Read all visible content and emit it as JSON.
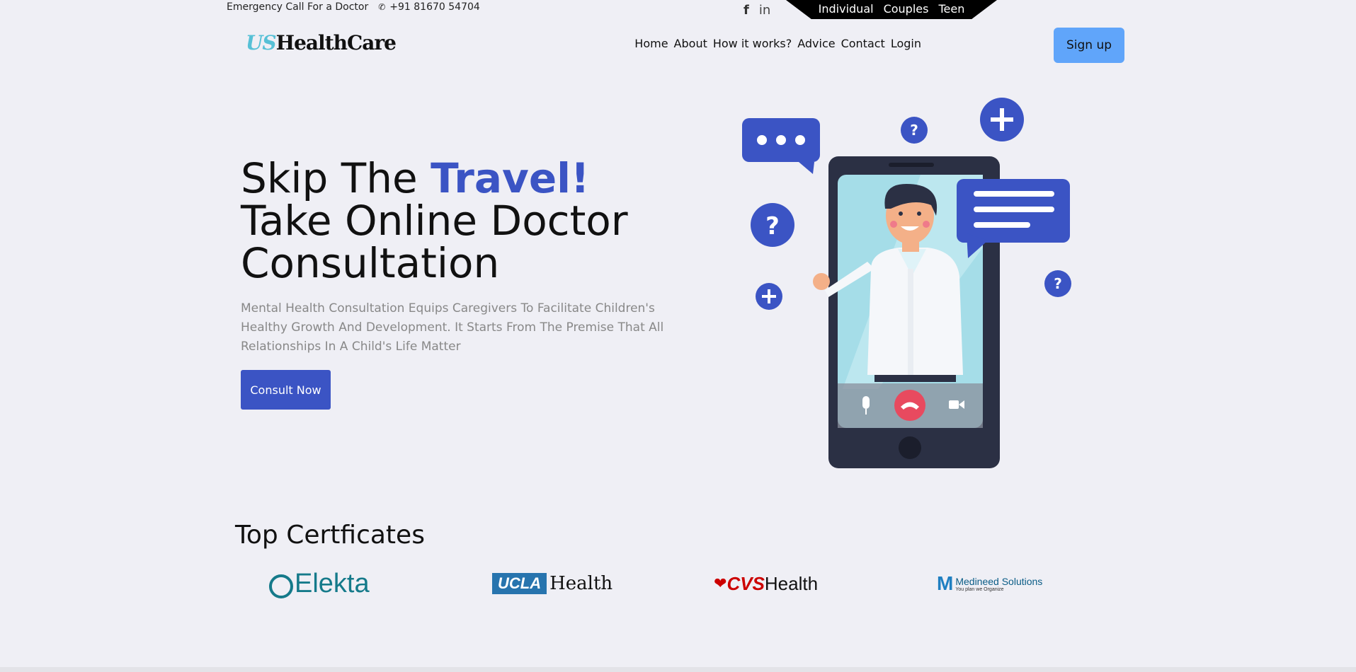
{
  "topbar": {
    "emergency_label": "Emergency Call For a Doctor",
    "phone": "+91 81670 54704",
    "audience": [
      "Individual",
      "Couples",
      "Teen"
    ]
  },
  "social": [
    "facebook-icon",
    "linkedin-icon"
  ],
  "brand": {
    "prefix": "US",
    "name": "HealthCare"
  },
  "nav": {
    "items": [
      "Home",
      "About",
      "How it works?",
      "Advice",
      "Contact",
      "Login"
    ],
    "signup": "Sign up"
  },
  "hero": {
    "title_part1": "Skip The ",
    "title_accent": "Travel!",
    "title_line2": "Take Online Doctor",
    "title_line3": "Consultation",
    "description": "Mental Health Consultation Equips Caregivers To Facilitate Children's Healthy Growth And Development. It Starts From The Premise That All Relationships In A Child's Life Matter",
    "cta": "Consult Now"
  },
  "certificates": {
    "title": "Top Certficates",
    "logos": [
      {
        "name": "Elekta"
      },
      {
        "box": "UCLA",
        "name": "Health"
      },
      {
        "prefix": "CVS",
        "name": "Health"
      },
      {
        "name": "Medineed Solutions",
        "tagline": "You plan we Organize"
      }
    ]
  },
  "colors": {
    "accent": "#3b54c4",
    "signup": "#60a5fa",
    "background": "#efeff5",
    "logo_teal": "#56c0d6"
  }
}
